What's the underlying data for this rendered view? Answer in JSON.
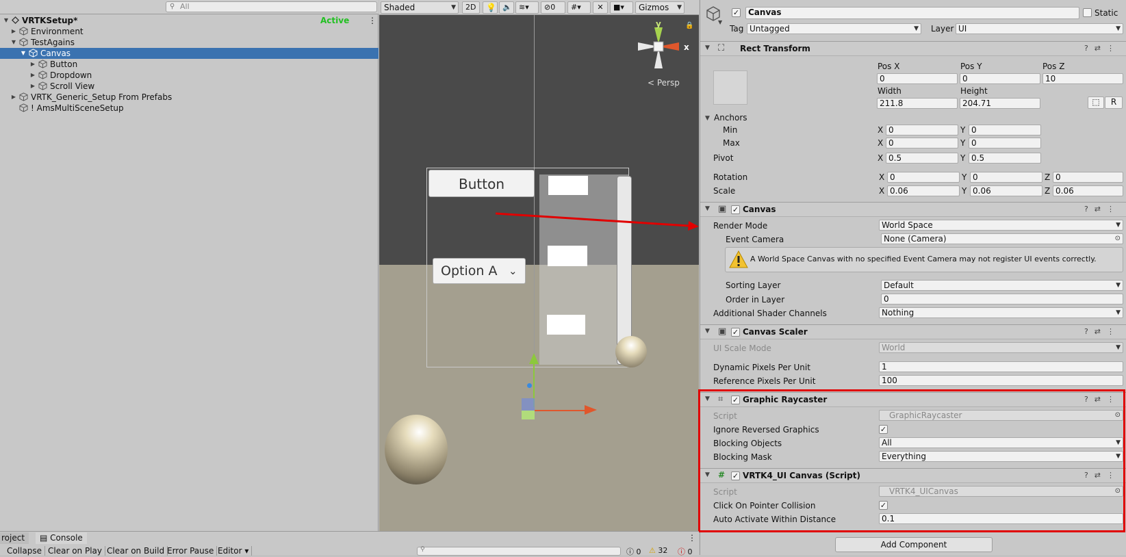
{
  "hierarchy": {
    "search_placeholder": "All",
    "scene_name": "VRTKSetup*",
    "active_label": "Active",
    "items": [
      {
        "label": "Environment"
      },
      {
        "label": "TestAgains"
      },
      {
        "label": "Canvas"
      },
      {
        "label": "Button"
      },
      {
        "label": "Dropdown"
      },
      {
        "label": "Scroll View"
      },
      {
        "label": "VRTK_Generic_Setup From Prefabs"
      },
      {
        "label": "! AmsMultiSceneSetup"
      }
    ]
  },
  "scene": {
    "shading_mode": "Shaded",
    "mode_2d": "2D",
    "hidden_count": "0",
    "gizmos_label": "Gizmos",
    "persp_label": "< Persp",
    "gizmo_y": "y",
    "gizmo_x": "x",
    "button_text": "Button",
    "dropdown_text": "Option A"
  },
  "inspector": {
    "object_name": "Canvas",
    "static_label": "Static",
    "tag_label": "Tag",
    "tag_value": "Untagged",
    "layer_label": "Layer",
    "layer_value": "UI",
    "rect_transform": {
      "title": "Rect Transform",
      "pos_x_label": "Pos X",
      "pos_y_label": "Pos Y",
      "pos_z_label": "Pos Z",
      "pos_x": "0",
      "pos_y": "0",
      "pos_z": "10",
      "width_label": "Width",
      "height_label": "Height",
      "width": "211.8",
      "height": "204.71",
      "r_button": "R",
      "anchors_label": "Anchors",
      "min_label": "Min",
      "min_x": "0",
      "min_y": "0",
      "max_label": "Max",
      "max_x": "0",
      "max_y": "0",
      "pivot_label": "Pivot",
      "pivot_x": "0.5",
      "pivot_y": "0.5",
      "rotation_label": "Rotation",
      "rot_x": "0",
      "rot_y": "0",
      "rot_z": "0",
      "scale_label": "Scale",
      "scale_x": "0.06",
      "scale_y": "0.06",
      "scale_z": "0.06",
      "x": "X",
      "y": "Y",
      "z": "Z"
    },
    "canvas": {
      "title": "Canvas",
      "render_mode_label": "Render Mode",
      "render_mode": "World Space",
      "event_camera_label": "Event Camera",
      "event_camera": "None (Camera)",
      "warning": "A World Space Canvas with no specified Event Camera may not register UI events correctly.",
      "sorting_layer_label": "Sorting Layer",
      "sorting_layer": "Default",
      "order_label": "Order in Layer",
      "order": "0",
      "shader_channels_label": "Additional Shader Channels",
      "shader_channels": "Nothing"
    },
    "canvas_scaler": {
      "title": "Canvas Scaler",
      "scale_mode_label": "UI Scale Mode",
      "scale_mode": "World",
      "dpu_label": "Dynamic Pixels Per Unit",
      "dpu": "1",
      "rppu_label": "Reference Pixels Per Unit",
      "rppu": "100"
    },
    "graphic_raycaster": {
      "title": "Graphic Raycaster",
      "script_label": "Script",
      "script": "GraphicRaycaster",
      "ignore_label": "Ignore Reversed Graphics",
      "blocking_objects_label": "Blocking Objects",
      "blocking_objects": "All",
      "blocking_mask_label": "Blocking Mask",
      "blocking_mask": "Everything"
    },
    "vrtk_canvas": {
      "title": "VRTK4_UI Canvas (Script)",
      "script_label": "Script",
      "script": "VRTK4_UICanvas",
      "click_label": "Click On Pointer Collision",
      "auto_label": "Auto Activate Within Distance",
      "auto_value": "0.1"
    },
    "add_component": "Add Component"
  },
  "console": {
    "project_tab": "roject",
    "console_tab": "Console",
    "buttons": [
      "Collapse",
      "Clear on Play",
      "Clear on Build",
      "Error Pause",
      "Editor"
    ],
    "info_count": "0",
    "warn_count": "32",
    "error_count": "0"
  },
  "colors": {
    "selection": "#3a72b0",
    "highlight": "#e00000",
    "active": "#22c022"
  }
}
